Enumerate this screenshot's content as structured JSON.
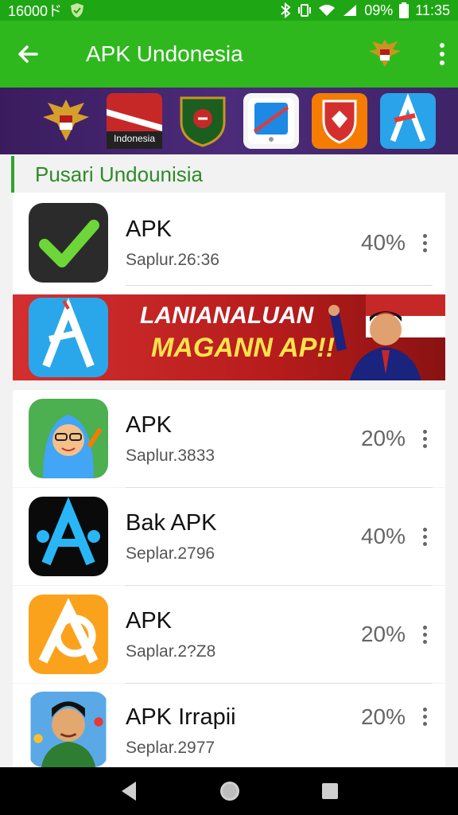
{
  "status_bar": {
    "left_text": "16000ド",
    "battery_percent": "09%",
    "time": "11:35"
  },
  "app_bar": {
    "title": "APK Undonesia"
  },
  "banner_strip": {
    "items": [
      {
        "icon": "garuda-emblem-icon"
      },
      {
        "icon": "indonesia-flag-app-icon",
        "label": "Indonesia"
      },
      {
        "icon": "shield-crest-icon"
      },
      {
        "icon": "blue-card-app-icon"
      },
      {
        "icon": "red-shield-app-icon"
      },
      {
        "icon": "blue-a-app-icon"
      }
    ]
  },
  "section": {
    "title": "Pusari Undounisia"
  },
  "apps": [
    {
      "name": "APK",
      "subtitle": "Saplur.26:36",
      "percent": "40%",
      "icon": "checkmark-app-icon"
    },
    {
      "name": "APK",
      "subtitle": "Saplur.3833",
      "percent": "20%",
      "icon": "cartoon-girl-app-icon"
    },
    {
      "name": "Bak APK",
      "subtitle": "Seplar.2796",
      "percent": "40%",
      "icon": "black-a-app-icon"
    },
    {
      "name": "APK",
      "subtitle": "Saplar.2?Z8",
      "percent": "20%",
      "icon": "orange-a-app-icon"
    },
    {
      "name": "APK Irrapii",
      "subtitle": "Seplar.2977",
      "percent": "20%",
      "icon": "cartoon-man-app-icon"
    }
  ],
  "ad": {
    "line1": "LANIANALUAN",
    "line2": "MAGANN AP!!",
    "icon": "blue-a-app-icon"
  },
  "colors": {
    "status_bar": "#1fa614",
    "app_bar": "#2fb81e",
    "section_accent": "#2fa52a"
  }
}
